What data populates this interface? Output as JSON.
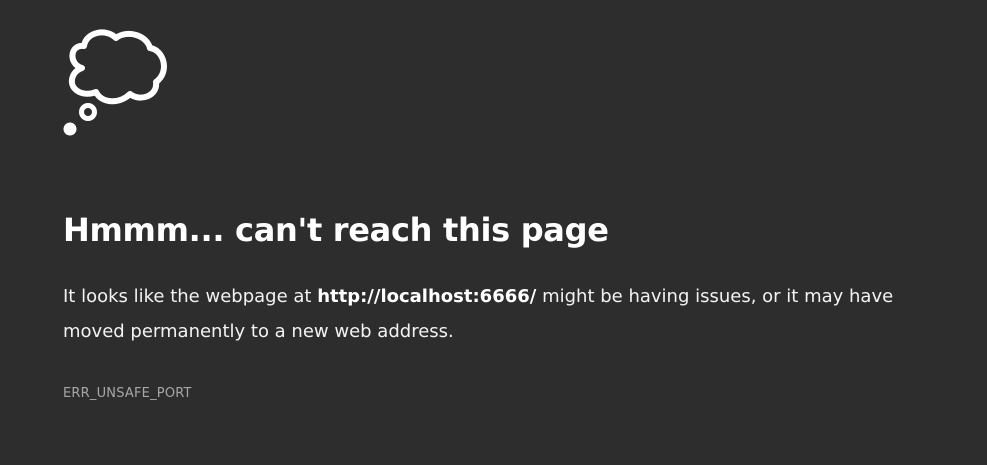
{
  "icon": "thought-bubble-icon",
  "colors": {
    "background": "#2d2d2d",
    "text": "#ffffff",
    "muted": "#a6a6a6"
  },
  "error_page": {
    "title": "Hmmm... can't reach this page",
    "message_prefix": "It looks like the webpage at ",
    "url": "http://localhost:6666/",
    "message_suffix": " might be having issues, or it may have moved permanently to a new web address.",
    "error_code": "ERR_UNSAFE_PORT"
  }
}
